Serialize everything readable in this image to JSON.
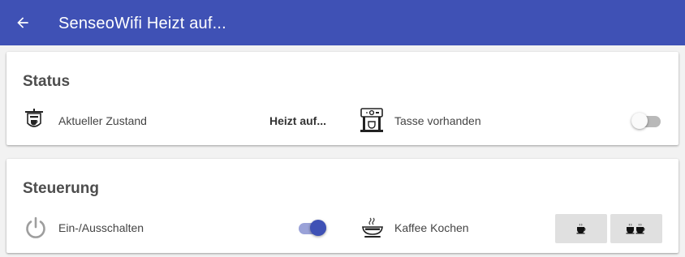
{
  "appbar": {
    "title": "SenseoWifi Heizt auf...",
    "back_icon": "arrow-left-icon",
    "color": "#3f51b5"
  },
  "status": {
    "title": "Status",
    "current_state": {
      "label": "Aktueller Zustand",
      "value": "Heizt auf...",
      "icon": "coffee-sign-icon"
    },
    "cup": {
      "label": "Tasse vorhanden",
      "on": false,
      "icon": "coffee-machine-icon"
    }
  },
  "control": {
    "title": "Steuerung",
    "power": {
      "label": "Ein-/Ausschalten",
      "on": true,
      "icon": "power-icon"
    },
    "brew": {
      "label": "Kaffee Kochen",
      "icon": "coffee-cup-icon",
      "buttons": [
        "one-cup",
        "two-cups"
      ]
    }
  },
  "accent_color": "#3f51b5"
}
